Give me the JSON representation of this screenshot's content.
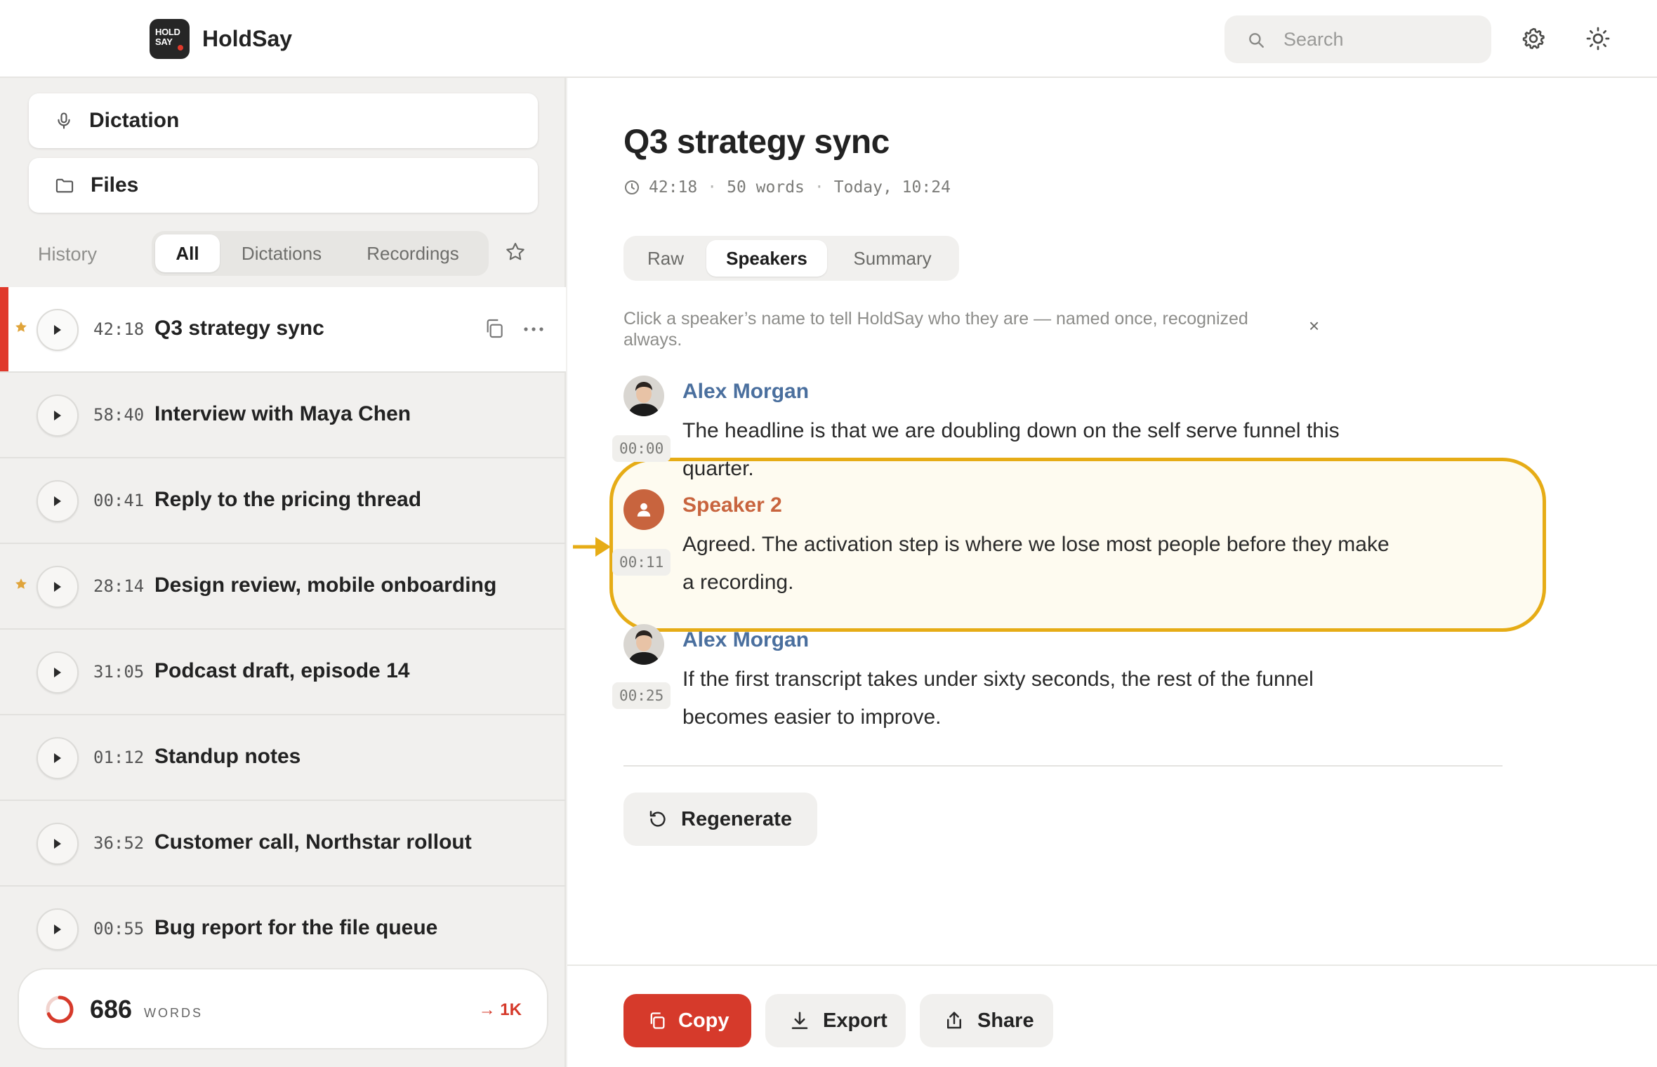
{
  "app": {
    "name": "HoldSay",
    "logo_line1": "HOLD",
    "logo_line2": "SAY"
  },
  "header": {
    "search_placeholder": "Search",
    "icons": [
      "search-icon",
      "gear-icon",
      "sun-icon"
    ]
  },
  "sidebar": {
    "nav": [
      {
        "label": "Dictation",
        "icon": "microphone-icon"
      },
      {
        "label": "Files",
        "icon": "folder-icon"
      }
    ],
    "history_label": "History",
    "filters": [
      "All",
      "Dictations",
      "Recordings"
    ],
    "active_filter": "All",
    "items": [
      {
        "time": "42:18",
        "title": "Q3 strategy sync",
        "starred": true,
        "active": true
      },
      {
        "time": "58:40",
        "title": "Interview with Maya Chen",
        "starred": false,
        "active": false
      },
      {
        "time": "00:41",
        "title": "Reply to the pricing thread",
        "starred": false,
        "active": false
      },
      {
        "time": "28:14",
        "title": "Design review, mobile onboarding",
        "starred": true,
        "active": false
      },
      {
        "time": "31:05",
        "title": "Podcast draft, episode 14",
        "starred": false,
        "active": false
      },
      {
        "time": "01:12",
        "title": "Standup notes",
        "starred": false,
        "active": false
      },
      {
        "time": "36:52",
        "title": "Customer call, Northstar rollout",
        "starred": false,
        "active": false
      },
      {
        "time": "00:55",
        "title": "Bug report for the file queue",
        "starred": false,
        "active": false
      }
    ],
    "words": {
      "count": "686",
      "label": "WORDS",
      "goal": "→ 1K",
      "progress": 0.686
    }
  },
  "main": {
    "title": "Q3 strategy sync",
    "meta": {
      "duration": "42:18",
      "sep": "·",
      "words": "50 words",
      "date": "Today, 10:24"
    },
    "tabs": [
      "Raw",
      "Speakers",
      "Summary"
    ],
    "active_tab": "Speakers",
    "hint": "Click a speaker’s name to tell HoldSay who they are — named once, recognized always.",
    "hint_close": "×",
    "segments": [
      {
        "speaker": "Alex Morgan",
        "known": true,
        "stamp": "00:00",
        "text": "The headline is that we are doubling down on the self serve funnel this quarter."
      },
      {
        "speaker": "Speaker 2",
        "known": false,
        "stamp": "00:11",
        "text": "Agreed. The activation step is where we lose most people before they make a recording."
      },
      {
        "speaker": "Alex Morgan",
        "known": true,
        "stamp": "00:25",
        "text": "If the first transcript takes under sixty seconds, the rest of the funnel becomes easier to improve."
      }
    ],
    "regenerate_label": "Regenerate",
    "footer": {
      "copy": "Copy",
      "export": "Export",
      "share": "Share"
    }
  },
  "colors": {
    "accent": "#d63a2b",
    "highlight": "#e6ac16",
    "known_speaker": "#4a6f9e",
    "unknown_speaker": "#c8643e",
    "star": "#e0a43a"
  }
}
